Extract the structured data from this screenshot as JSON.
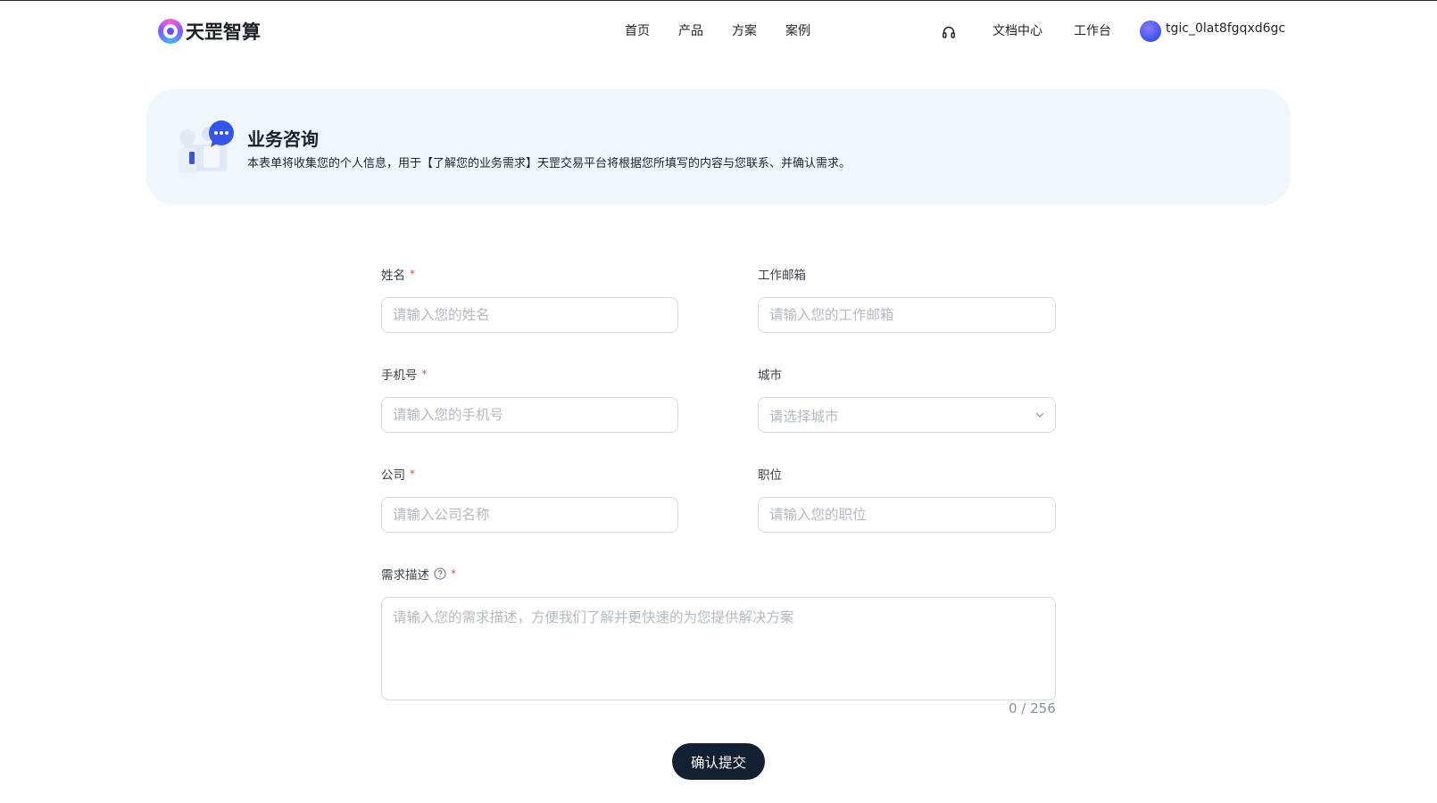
{
  "header": {
    "logo_text": "天罡智算",
    "nav": [
      "首页",
      "产品",
      "方案",
      "案例"
    ],
    "support_icon": "headset-icon",
    "docs_link": "文档中心",
    "workbench_link": "工作台",
    "username": "tgic_0lat8fgqxd6gc"
  },
  "banner": {
    "title": "业务咨询",
    "description": "本表单将收集您的个人信息，用于【了解您的业务需求】天罡交易平台将根据您所填写的内容与您联系、并确认需求。"
  },
  "form": {
    "name_label": "姓名",
    "name_placeholder": "请输入您的姓名",
    "email_label": "工作邮箱",
    "email_placeholder": "请输入您的工作邮箱",
    "phone_label": "手机号",
    "phone_placeholder": "请输入您的手机号",
    "city_label": "城市",
    "city_placeholder": "请选择城市",
    "company_label": "公司",
    "company_placeholder": "请输入公司名称",
    "position_label": "职位",
    "position_placeholder": "请输入您的职位",
    "desc_label": "需求描述",
    "desc_placeholder": "请输入您的需求描述，方便我们了解并更快速的为您提供解决方案",
    "desc_counter": "0 / 256",
    "required_mark": "*",
    "submit_label": "确认提交"
  },
  "colors": {
    "accent_dark": "#132033",
    "banner_bg": "#eff6fe",
    "required": "#e8473c"
  }
}
